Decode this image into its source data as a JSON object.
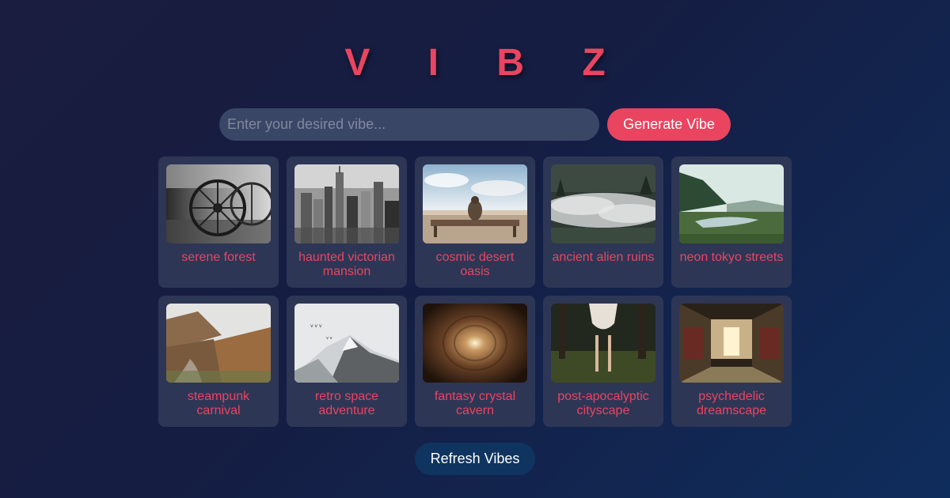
{
  "app": {
    "title": "V I B Z",
    "accent_color": "#e94560",
    "secondary_button_color": "#0f3460"
  },
  "search": {
    "value": "",
    "placeholder": "Enter your desired vibe...",
    "generate_label": "Generate Vibe"
  },
  "cards": [
    {
      "label": "serene forest",
      "image": "wagon-wheels-photo"
    },
    {
      "label": "haunted victorian mansion",
      "image": "city-skyline-photo"
    },
    {
      "label": "cosmic desert oasis",
      "image": "bench-sky-photo"
    },
    {
      "label": "ancient alien ruins",
      "image": "misty-forest-photo"
    },
    {
      "label": "neon tokyo streets",
      "image": "river-valley-photo"
    },
    {
      "label": "steampunk carnival",
      "image": "autumn-mountain-trail-photo"
    },
    {
      "label": "retro space adventure",
      "image": "snowy-mountain-birds-photo"
    },
    {
      "label": "fantasy crystal cavern",
      "image": "light-tunnel-photo"
    },
    {
      "label": "post-apocalyptic cityscape",
      "image": "woman-in-forest-photo"
    },
    {
      "label": "psychedelic dreamscape",
      "image": "train-interior-photo"
    }
  ],
  "footer": {
    "refresh_label": "Refresh Vibes"
  }
}
